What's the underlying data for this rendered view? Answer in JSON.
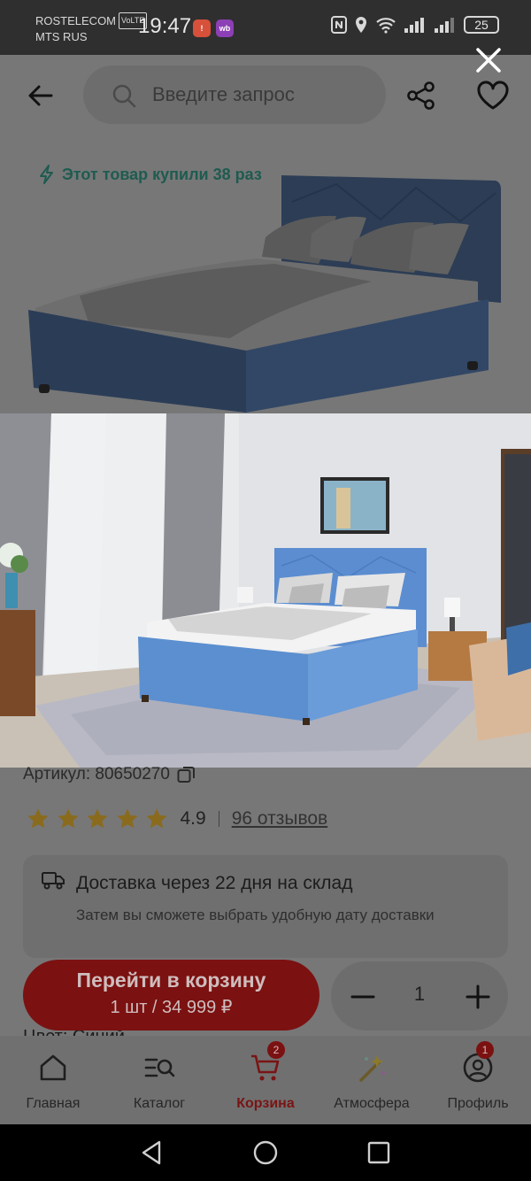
{
  "status_bar": {
    "carrier_1": "ROSTELECOM",
    "volte": "VoLTE",
    "carrier_2": "MTS RUS",
    "time": "19:47",
    "notif_1": "!",
    "notif_2": "wb",
    "battery": "25"
  },
  "header": {
    "search_placeholder": "Введите запрос"
  },
  "product": {
    "bought_text": "Этот товар купили 38 раз",
    "article": "Артикул: 80650270",
    "rating": "4.9",
    "stars": 5,
    "reviews": "96 отзывов",
    "color_label": "Цвет: Синий"
  },
  "delivery": {
    "title": "Доставка через 22 дня на склад",
    "subtitle": "Затем вы сможете выбрать удобную дату доставки"
  },
  "cart": {
    "label": "Перейти в корзину",
    "summary": "1 шт / 34 999 ₽",
    "quantity": "1"
  },
  "tabs": [
    {
      "label": "Главная",
      "icon": "home-icon"
    },
    {
      "label": "Каталог",
      "icon": "catalog-search-icon"
    },
    {
      "label": "Корзина",
      "icon": "cart-icon",
      "badge": "2"
    },
    {
      "label": "Атмосфера",
      "icon": "magic-wand-icon"
    },
    {
      "label": "Профиль",
      "icon": "profile-icon",
      "badge": "1"
    }
  ],
  "colors": {
    "accent": "#7b1111",
    "overlay_dim": "#777777",
    "bought_green": "#1f5b50",
    "star": "#b8860b"
  }
}
